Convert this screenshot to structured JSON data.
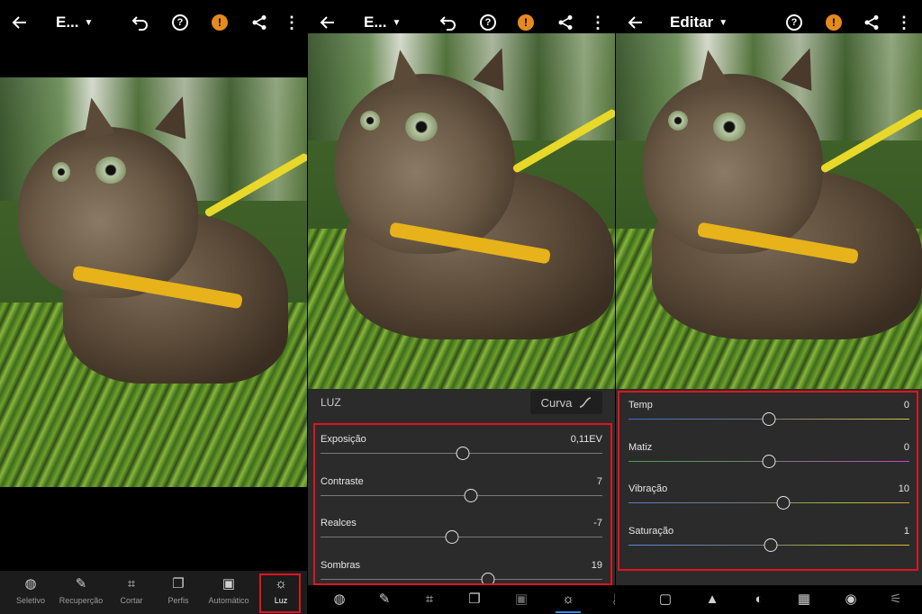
{
  "colors": {
    "accent": "#2d8ceb",
    "highlight": "#e0141e",
    "warning": "#e68a1f",
    "panel": "#2b2b2b"
  },
  "panel1": {
    "topbar": {
      "title": "E...",
      "icons": [
        "back-arrow-icon",
        "undo-icon",
        "help-icon",
        "warning-icon",
        "share-icon",
        "more-icon"
      ]
    },
    "tools": [
      {
        "label": "Seletivo",
        "icon": "selective-icon"
      },
      {
        "label": "Recuperção",
        "icon": "healing-icon"
      },
      {
        "label": "Cortar",
        "icon": "crop-icon"
      },
      {
        "label": "Perfis",
        "icon": "profiles-icon"
      },
      {
        "label": "Automático",
        "icon": "auto-icon"
      },
      {
        "label": "Luz",
        "icon": "light-icon",
        "active": true
      }
    ]
  },
  "panel2": {
    "topbar": {
      "title": "E..."
    },
    "light": {
      "title": "LUZ",
      "curve_label": "Curva",
      "sliders": [
        {
          "label": "Exposição",
          "value": "0,11EV",
          "position": 0.505
        },
        {
          "label": "Contraste",
          "value": "7",
          "position": 0.535
        },
        {
          "label": "Realces",
          "value": "-7",
          "position": 0.465
        },
        {
          "label": "Sombras",
          "value": "19",
          "position": 0.595
        }
      ]
    }
  },
  "panel3": {
    "topbar": {
      "title": "Editar"
    },
    "color": {
      "sliders": [
        {
          "label": "Temp",
          "value": "0",
          "position": 0.5
        },
        {
          "label": "Matiz",
          "value": "0",
          "position": 0.5
        },
        {
          "label": "Vibração",
          "value": "10",
          "position": 0.55
        },
        {
          "label": "Saturação",
          "value": "1",
          "position": 0.505
        }
      ]
    }
  }
}
